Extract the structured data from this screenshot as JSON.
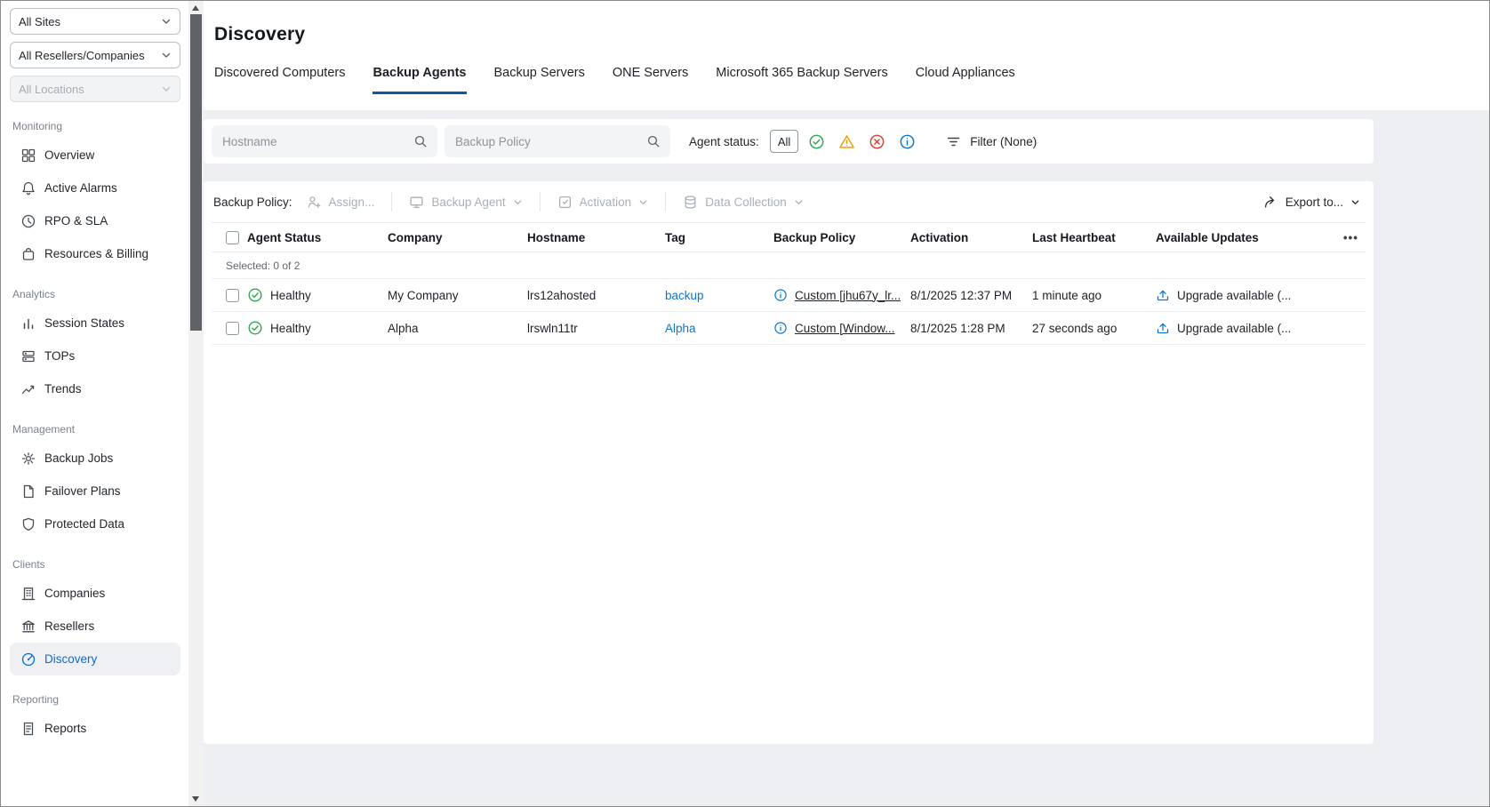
{
  "sidebar": {
    "filters": [
      {
        "label": "All Sites",
        "disabled": false
      },
      {
        "label": "All Resellers/Companies",
        "disabled": false
      },
      {
        "label": "All Locations",
        "disabled": true
      }
    ],
    "sections": [
      {
        "label": "Monitoring",
        "items": [
          {
            "label": "Overview",
            "icon": "overview-icon"
          },
          {
            "label": "Active Alarms",
            "icon": "bell-icon"
          },
          {
            "label": "RPO & SLA",
            "icon": "clock-icon"
          },
          {
            "label": "Resources & Billing",
            "icon": "bag-icon"
          }
        ]
      },
      {
        "label": "Analytics",
        "items": [
          {
            "label": "Session States",
            "icon": "bar-chart-icon"
          },
          {
            "label": "TOPs",
            "icon": "server-icon"
          },
          {
            "label": "Trends",
            "icon": "trend-icon"
          }
        ]
      },
      {
        "label": "Management",
        "items": [
          {
            "label": "Backup Jobs",
            "icon": "gear-icon"
          },
          {
            "label": "Failover Plans",
            "icon": "document-icon"
          },
          {
            "label": "Protected Data",
            "icon": "shield-icon"
          }
        ]
      },
      {
        "label": "Clients",
        "items": [
          {
            "label": "Companies",
            "icon": "building-icon"
          },
          {
            "label": "Resellers",
            "icon": "bank-icon"
          },
          {
            "label": "Discovery",
            "icon": "radar-icon",
            "active": true
          }
        ]
      },
      {
        "label": "Reporting",
        "items": [
          {
            "label": "Reports",
            "icon": "report-icon"
          }
        ]
      }
    ]
  },
  "header": {
    "title": "Discovery"
  },
  "tabs": [
    {
      "label": "Discovered Computers",
      "active": false
    },
    {
      "label": "Backup Agents",
      "active": true
    },
    {
      "label": "Backup Servers",
      "active": false
    },
    {
      "label": "ONE Servers",
      "active": false
    },
    {
      "label": "Microsoft 365 Backup Servers",
      "active": false
    },
    {
      "label": "Cloud Appliances",
      "active": false
    }
  ],
  "filter_bar": {
    "hostname_placeholder": "Hostname",
    "policy_placeholder": "Backup Policy",
    "agent_status_label": "Agent status:",
    "all_label": "All",
    "status_filters": [
      "healthy",
      "warning",
      "error",
      "info"
    ],
    "filter_label": "Filter (None)"
  },
  "toolbar": {
    "group_label": "Backup Policy:",
    "assign_label": "Assign...",
    "backup_agent_label": "Backup Agent",
    "activation_label": "Activation",
    "data_collection_label": "Data Collection",
    "export_label": "Export to..."
  },
  "table": {
    "columns": [
      "Agent Status",
      "Company",
      "Hostname",
      "Tag",
      "Backup Policy",
      "Activation",
      "Last Heartbeat",
      "Available Updates"
    ],
    "column_menu": "•••",
    "selected_text": "Selected: 0 of 2",
    "rows": [
      {
        "status": "Healthy",
        "company": "My Company",
        "hostname": "lrs12ahosted",
        "tag": "backup",
        "policy": "Custom [jhu67y_lr...",
        "activation": "8/1/2025 12:37 PM",
        "heartbeat": "1 minute ago",
        "updates": "Upgrade available (..."
      },
      {
        "status": "Healthy",
        "company": "Alpha",
        "hostname": "lrswln11tr",
        "tag": "Alpha",
        "policy": "Custom [Window...",
        "activation": "8/1/2025 1:28 PM",
        "heartbeat": "27 seconds ago",
        "updates": "Upgrade available (..."
      }
    ]
  },
  "colors": {
    "accent_blue": "#0c6cd4",
    "tab_underline": "#0b57a8",
    "link_blue": "#0f74d1",
    "healthy_green": "#2fa84f",
    "warning_yellow": "#f0a000",
    "error_red": "#e03e36",
    "info_blue": "#0c77cf",
    "page_background": "#edeff2"
  }
}
